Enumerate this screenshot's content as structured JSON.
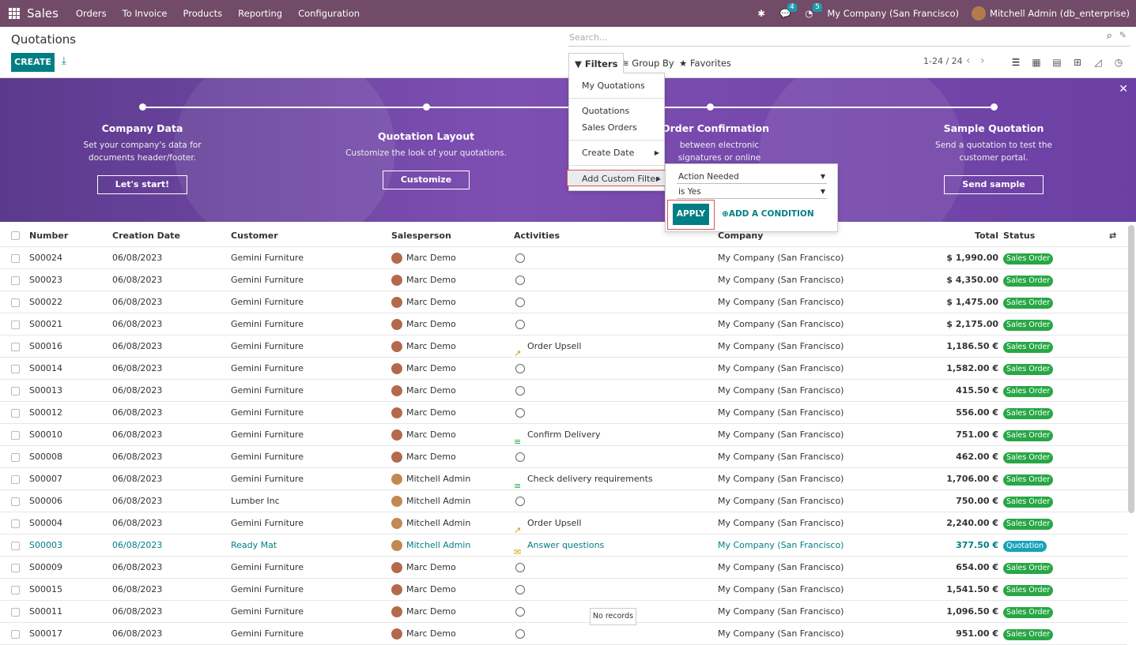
{
  "topbar": {
    "app": "Sales",
    "menus": [
      "Orders",
      "To Invoice",
      "Products",
      "Reporting",
      "Configuration"
    ],
    "messages_badge": "4",
    "activity_badge": "5",
    "company": "My Company (San Francisco)",
    "user": "Mitchell Admin (db_enterprise)"
  },
  "control": {
    "title": "Quotations",
    "create_label": "CREATE",
    "search_placeholder": "Search...",
    "filters_label": "Filters",
    "groupby_label": "Group By",
    "favorites_label": "Favorites",
    "pager": "1-24 / 24"
  },
  "banner": {
    "steps": [
      {
        "title": "Company Data",
        "text": "Set your company's data for documents header/footer.",
        "button": "Let's start!"
      },
      {
        "title": "Quotation Layout",
        "text": "Customize the look of your quotations.",
        "button": "Customize"
      },
      {
        "title": "Order Confirmation",
        "text": "between electronic signatures or online payments.",
        "button": ""
      },
      {
        "title": "Sample Quotation",
        "text": "Send a quotation to test the customer portal.",
        "button": "Send sample"
      }
    ]
  },
  "filters_menu": {
    "items": [
      "My Quotations",
      "Quotations",
      "Sales Orders",
      "Create Date",
      "Add Custom Filter"
    ]
  },
  "custom_filter": {
    "field": "Action Needed",
    "operator": "is Yes",
    "apply": "APPLY",
    "add_condition": "ADD A CONDITION"
  },
  "table": {
    "headers": [
      "Number",
      "Creation Date",
      "Customer",
      "Salesperson",
      "Activities",
      "Company",
      "Total",
      "Status"
    ],
    "rows": [
      {
        "num": "S00024",
        "date": "06/08/2023",
        "customer": "Gemini Furniture",
        "sales": "Marc Demo",
        "activity": "",
        "company": "My Company (San Francisco)",
        "total": "$ 1,990.00",
        "status": "Sales Order"
      },
      {
        "num": "S00023",
        "date": "06/08/2023",
        "customer": "Gemini Furniture",
        "sales": "Marc Demo",
        "activity": "",
        "company": "My Company (San Francisco)",
        "total": "$ 4,350.00",
        "status": "Sales Order"
      },
      {
        "num": "S00022",
        "date": "06/08/2023",
        "customer": "Gemini Furniture",
        "sales": "Marc Demo",
        "activity": "",
        "company": "My Company (San Francisco)",
        "total": "$ 1,475.00",
        "status": "Sales Order"
      },
      {
        "num": "S00021",
        "date": "06/08/2023",
        "customer": "Gemini Furniture",
        "sales": "Marc Demo",
        "activity": "",
        "company": "My Company (San Francisco)",
        "total": "$ 2,175.00",
        "status": "Sales Order"
      },
      {
        "num": "S00016",
        "date": "06/08/2023",
        "customer": "Gemini Furniture",
        "sales": "Marc Demo",
        "activity": "Order Upsell",
        "icon": "chart",
        "company": "My Company (San Francisco)",
        "total": "1,186.50 €",
        "status": "Sales Order"
      },
      {
        "num": "S00014",
        "date": "06/08/2023",
        "customer": "Gemini Furniture",
        "sales": "Marc Demo",
        "activity": "",
        "company": "My Company (San Francisco)",
        "total": "1,582.00 €",
        "status": "Sales Order"
      },
      {
        "num": "S00013",
        "date": "06/08/2023",
        "customer": "Gemini Furniture",
        "sales": "Marc Demo",
        "activity": "",
        "company": "My Company (San Francisco)",
        "total": "415.50 €",
        "status": "Sales Order"
      },
      {
        "num": "S00012",
        "date": "06/08/2023",
        "customer": "Gemini Furniture",
        "sales": "Marc Demo",
        "activity": "",
        "company": "My Company (San Francisco)",
        "total": "556.00 €",
        "status": "Sales Order"
      },
      {
        "num": "S00010",
        "date": "06/08/2023",
        "customer": "Gemini Furniture",
        "sales": "Marc Demo",
        "activity": "Confirm Delivery",
        "icon": "list",
        "company": "My Company (San Francisco)",
        "total": "751.00 €",
        "status": "Sales Order"
      },
      {
        "num": "S00008",
        "date": "06/08/2023",
        "customer": "Gemini Furniture",
        "sales": "Marc Demo",
        "activity": "",
        "company": "My Company (San Francisco)",
        "total": "462.00 €",
        "status": "Sales Order"
      },
      {
        "num": "S00007",
        "date": "06/08/2023",
        "customer": "Gemini Furniture",
        "sales": "Mitchell Admin",
        "activity": "Check delivery requirements",
        "icon": "list",
        "company": "My Company (San Francisco)",
        "total": "1,706.00 €",
        "status": "Sales Order"
      },
      {
        "num": "S00006",
        "date": "06/08/2023",
        "customer": "Lumber Inc",
        "sales": "Mitchell Admin",
        "activity": "",
        "company": "My Company (San Francisco)",
        "total": "750.00 €",
        "status": "Sales Order"
      },
      {
        "num": "S00004",
        "date": "06/08/2023",
        "customer": "Gemini Furniture",
        "sales": "Mitchell Admin",
        "activity": "Order Upsell",
        "icon": "chart",
        "company": "My Company (San Francisco)",
        "total": "2,240.00 €",
        "status": "Sales Order"
      },
      {
        "num": "S00003",
        "date": "06/08/2023",
        "customer": "Ready Mat",
        "sales": "Mitchell Admin",
        "activity": "Answer questions",
        "icon": "mail",
        "company": "My Company (San Francisco)",
        "total": "377.50 €",
        "status": "Quotation",
        "highlight": true
      },
      {
        "num": "S00009",
        "date": "06/08/2023",
        "customer": "Gemini Furniture",
        "sales": "Marc Demo",
        "activity": "",
        "company": "My Company (San Francisco)",
        "total": "654.00 €",
        "status": "Sales Order"
      },
      {
        "num": "S00015",
        "date": "06/08/2023",
        "customer": "Gemini Furniture",
        "sales": "Marc Demo",
        "activity": "",
        "company": "My Company (San Francisco)",
        "total": "1,541.50 €",
        "status": "Sales Order"
      },
      {
        "num": "S00011",
        "date": "06/08/2023",
        "customer": "Gemini Furniture",
        "sales": "Marc Demo",
        "activity": "",
        "company": "My Company (San Francisco)",
        "total": "1,096.50 €",
        "status": "Sales Order"
      },
      {
        "num": "S00017",
        "date": "06/08/2023",
        "customer": "Gemini Furniture",
        "sales": "Marc Demo",
        "activity": "",
        "company": "My Company (San Francisco)",
        "total": "951.00 €",
        "status": "Sales Order"
      }
    ]
  },
  "tooltip": "No records",
  "colors": {
    "topbar": "#714b67",
    "accent": "#017e84",
    "status_green": "#28a745",
    "status_blue": "#17a2b8"
  }
}
